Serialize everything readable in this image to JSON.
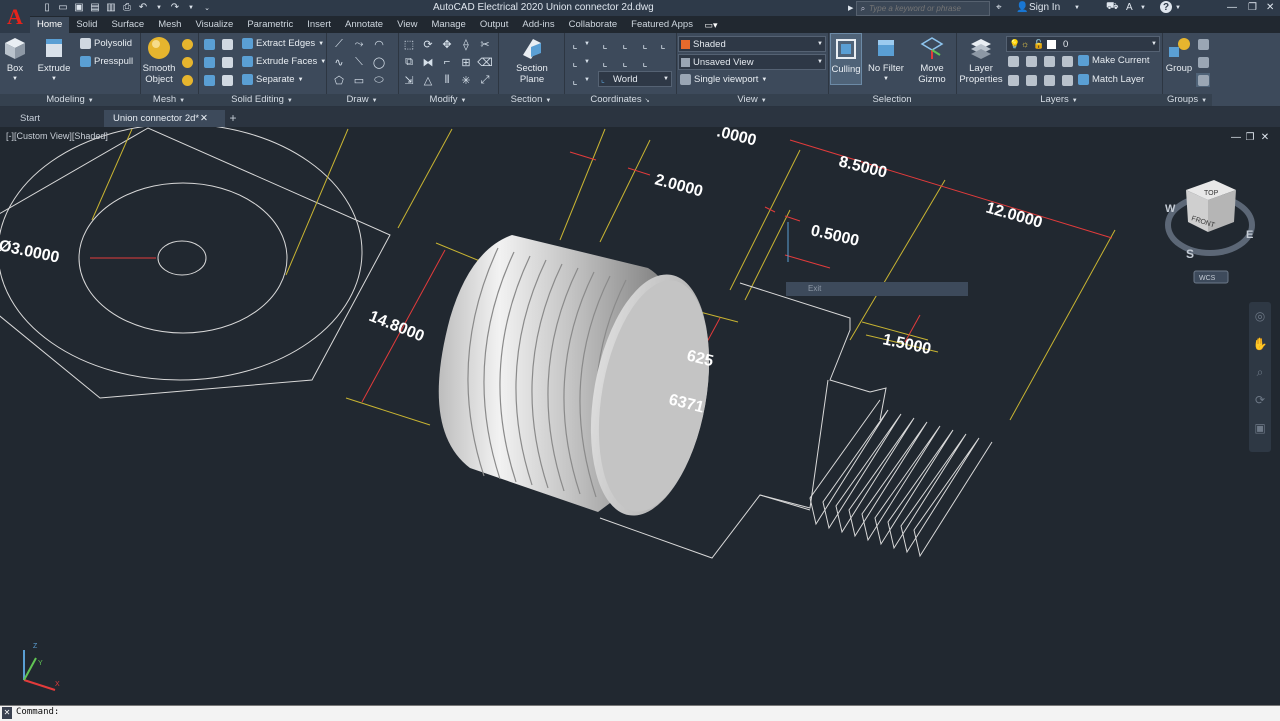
{
  "app": {
    "logo_letter": "A",
    "title": "AutoCAD Electrical 2020   Union connector 2d.dwg"
  },
  "search": {
    "placeholder": "Type a keyword or phrase"
  },
  "account": {
    "sign_in": "Sign In"
  },
  "menu_tabs": [
    "Home",
    "Solid",
    "Surface",
    "Mesh",
    "Visualize",
    "Parametric",
    "Insert",
    "Annotate",
    "View",
    "Manage",
    "Output",
    "Add-ins",
    "Collaborate",
    "Featured Apps"
  ],
  "active_tab": "Home",
  "ribbon": {
    "box": "Box",
    "extrude": "Extrude",
    "polysolid": "Polysolid",
    "presspull": "Presspull",
    "modeling_title": "Modeling",
    "smooth_object_1": "Smooth",
    "smooth_object_2": "Object",
    "mesh_title": "Mesh",
    "extract_edges": "Extract Edges",
    "extrude_faces": "Extrude Faces",
    "separate": "Separate",
    "solid_editing_title": "Solid Editing",
    "draw_title": "Draw",
    "modify_title": "Modify",
    "section_plane_1": "Section",
    "section_plane_2": "Plane",
    "section_title": "Section",
    "world": "World",
    "coordinates_title": "Coordinates",
    "visual_style": "Shaded",
    "named_view": "Unsaved View",
    "viewport_config": "Single viewport",
    "view_title": "View",
    "culling": "Culling",
    "no_filter": "No Filter",
    "move_gizmo_1": "Move",
    "move_gizmo_2": "Gizmo",
    "selection_title": "Selection",
    "layer_properties_1": "Layer",
    "layer_properties_2": "Properties",
    "layer_current": "0",
    "make_current": "Make Current",
    "match_layer": "Match Layer",
    "layers_title": "Layers",
    "group": "Group",
    "groups_title": "Groups"
  },
  "doc_tabs": {
    "start": "Start",
    "active": "Union connector 2d*",
    "close": "✕",
    "new": "+"
  },
  "viewport": {
    "label": "[-][Custom View][Shaded]",
    "tooltip": "Exit",
    "dimensions": {
      "d_dia": "Ø3.0000",
      "d_148": "14.8000",
      "d_2": "2.0000",
      "d_05": "0.5000",
      "d_85": "8.5000",
      "d_12": "12.0000",
      "d_15": "1.5000",
      "d_625": "625",
      "d_6371": "6371",
      "d_top": ".0000"
    },
    "viewcube": {
      "top": "TOP",
      "front": "FRONT",
      "w": "W",
      "e": "E",
      "s": "S",
      "wcs": "WCS"
    },
    "ucs": {
      "z": "Z",
      "y": "Y",
      "x": "X"
    }
  },
  "command": {
    "prompt": "Command:"
  },
  "colors": {
    "accent": "#5a9fd4",
    "dimension": "#e23b3b",
    "construction": "#c8b432",
    "background": "#212830",
    "ribbon": "#3d4a5b"
  }
}
